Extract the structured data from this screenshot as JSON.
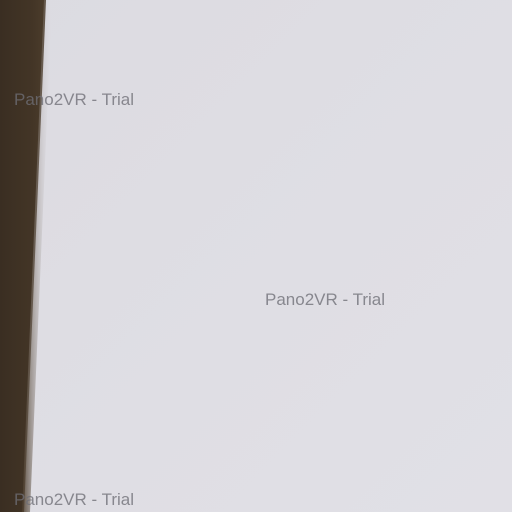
{
  "watermark": {
    "text": "Pano2VR - Trial"
  },
  "colors": {
    "wall": "#dedde3",
    "frame_dark": "#3e3224",
    "watermark": "#6e6e76"
  }
}
